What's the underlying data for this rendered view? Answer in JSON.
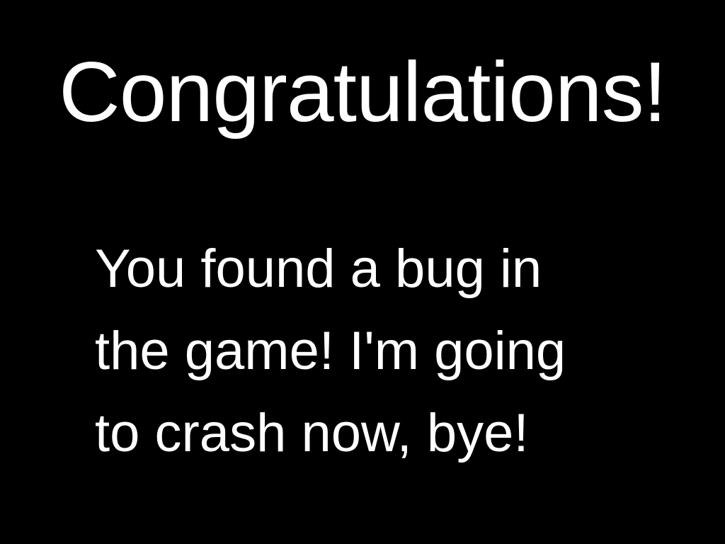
{
  "screen": {
    "title": "Congratulations!",
    "message_lines": [
      "You found a bug in",
      "the game! I'm going",
      "to crash now, bye!"
    ]
  },
  "colors": {
    "background": "#000000",
    "text": "#ffffff"
  }
}
